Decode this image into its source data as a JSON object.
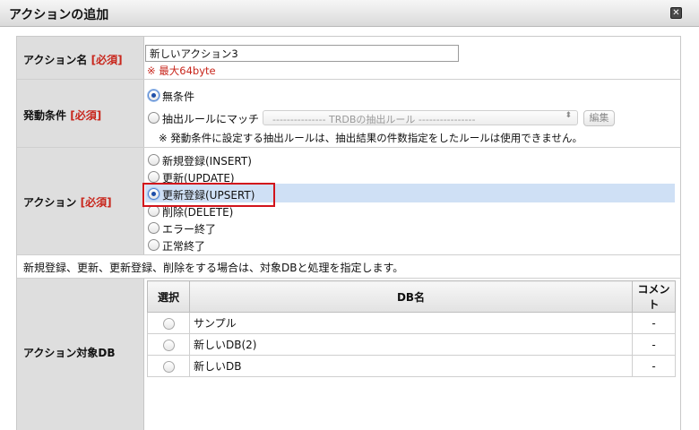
{
  "dialog": {
    "title": "アクションの追加",
    "close_glyph": "✕"
  },
  "action_name": {
    "label": "アクション名",
    "required": "[必須]",
    "value": "新しいアクション3",
    "hint": "※ 最大64byte"
  },
  "trigger": {
    "label": "発動条件",
    "required": "[必須]",
    "options": [
      {
        "label": "無条件",
        "checked": true
      },
      {
        "label": "抽出ルールにマッチ",
        "checked": false
      }
    ],
    "rule_select_value": "--------------- TRDBの抽出ルール ----------------",
    "edit_button": "編集",
    "note": "※ 発動条件に設定する抽出ルールは、抽出結果の件数指定をしたルールは使用できません。"
  },
  "action": {
    "label": "アクション",
    "required": "[必須]",
    "options": [
      {
        "label": "新規登録(INSERT)",
        "checked": false
      },
      {
        "label": "更新(UPDATE)",
        "checked": false
      },
      {
        "label": "更新登録(UPSERT)",
        "checked": true
      },
      {
        "label": "削除(DELETE)",
        "checked": false
      },
      {
        "label": "エラー終了",
        "checked": false
      },
      {
        "label": "正常終了",
        "checked": false
      }
    ]
  },
  "target_note": "新規登録、更新、更新登録、削除をする場合は、対象DBと処理を指定します。",
  "target_db": {
    "label": "アクション対象DB",
    "columns": [
      "選択",
      "DB名",
      "コメント"
    ],
    "rows": [
      {
        "name": "サンプル",
        "comment": "-"
      },
      {
        "name": "新しいDB(2)",
        "comment": "-"
      },
      {
        "name": "新しいDB",
        "comment": "-"
      }
    ]
  },
  "colors": {
    "required": "#c8261c",
    "highlight": "#cfe0f5",
    "annotation_box": "#d2141b"
  }
}
